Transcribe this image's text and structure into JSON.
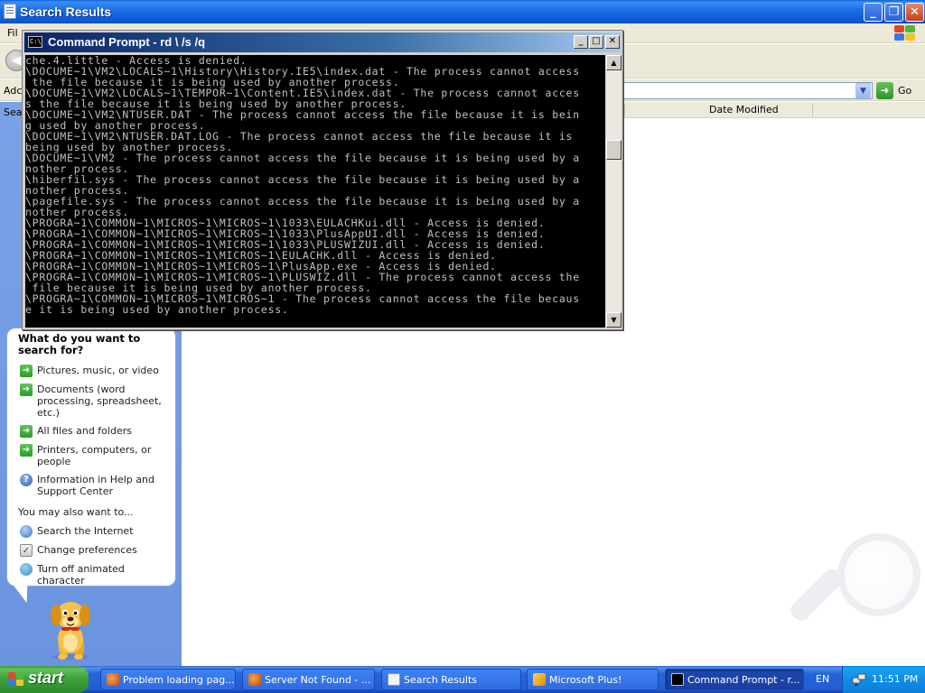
{
  "search_window": {
    "title": "Search Results",
    "menu_peek": "Fil",
    "address_label": "Adc",
    "search_label": "Sea",
    "go_label": "Go",
    "column_header": "Date Modified"
  },
  "assistant": {
    "heading": "What do you want to search for?",
    "options": [
      {
        "label": "Pictures, music, or video",
        "icon": "green-arrow-icon"
      },
      {
        "label": "Documents (word processing, spreadsheet, etc.)",
        "icon": "green-arrow-icon"
      },
      {
        "label": "All files and folders",
        "icon": "green-arrow-icon"
      },
      {
        "label": "Printers, computers, or people",
        "icon": "green-arrow-icon"
      },
      {
        "label": "Information in Help and Support Center",
        "icon": "help-icon"
      }
    ],
    "also_heading": "You may also want to...",
    "also_options": [
      {
        "label": "Search the Internet",
        "icon": "globe-icon"
      },
      {
        "label": "Change preferences",
        "icon": "preferences-icon"
      },
      {
        "label": "Turn off animated character",
        "icon": "character-icon"
      }
    ]
  },
  "cmd": {
    "title": "Command Prompt - rd \\ /s /q",
    "lines": [
      "che.4.little - Access is denied.",
      "\\DOCUME~1\\VM2\\LOCALS~1\\History\\History.IE5\\index.dat - The process cannot access",
      " the file because it is being used by another process.",
      "\\DOCUME~1\\VM2\\LOCALS~1\\TEMPOR~1\\Content.IE5\\index.dat - The process cannot acces",
      "s the file because it is being used by another process.",
      "\\DOCUME~1\\VM2\\NTUSER.DAT - The process cannot access the file because it is bein",
      "g used by another process.",
      "\\DOCUME~1\\VM2\\NTUSER.DAT.LOG - The process cannot access the file because it is",
      "being used by another process.",
      "\\DOCUME~1\\VM2 - The process cannot access the file because it is being used by a",
      "nother process.",
      "\\hiberfil.sys - The process cannot access the file because it is being used by a",
      "nother process.",
      "\\pagefile.sys - The process cannot access the file because it is being used by a",
      "nother process.",
      "\\PROGRA~1\\COMMON~1\\MICROS~1\\MICROS~1\\1033\\EULACHKui.dll - Access is denied.",
      "\\PROGRA~1\\COMMON~1\\MICROS~1\\MICROS~1\\1033\\PlusAppUI.dll - Access is denied.",
      "\\PROGRA~1\\COMMON~1\\MICROS~1\\MICROS~1\\1033\\PLUSWIZUI.dll - Access is denied.",
      "\\PROGRA~1\\COMMON~1\\MICROS~1\\MICROS~1\\EULACHK.dll - Access is denied.",
      "\\PROGRA~1\\COMMON~1\\MICROS~1\\MICROS~1\\PlusApp.exe - Access is denied.",
      "\\PROGRA~1\\COMMON~1\\MICROS~1\\MICROS~1\\PLUSWIZ.dll - The process cannot access the",
      " file because it is being used by another process.",
      "\\PROGRA~1\\COMMON~1\\MICROS~1\\MICROS~1 - The process cannot access the file becaus",
      "e it is being used by another process."
    ]
  },
  "taskbar": {
    "start_label": "start",
    "tasks": [
      {
        "label": "Problem loading pag...",
        "icon": "firefox-icon"
      },
      {
        "label": "Server Not Found - ...",
        "icon": "firefox-icon"
      },
      {
        "label": "Search Results",
        "icon": "search-folder-icon"
      },
      {
        "label": "Microsoft Plus!",
        "icon": "plus-icon"
      },
      {
        "label": "Command Prompt - r...",
        "icon": "cmd-icon"
      }
    ],
    "language": "EN",
    "clock": "11:51 PM"
  }
}
